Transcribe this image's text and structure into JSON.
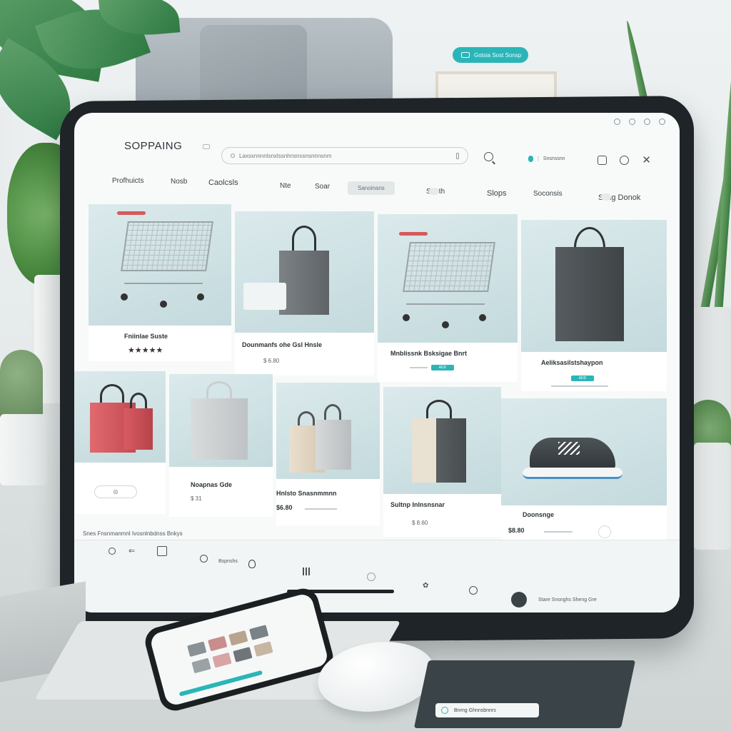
{
  "background_pill": {
    "text": "Gotsia Sost Sonsp"
  },
  "app": {
    "brand": "SOPPAING"
  },
  "search": {
    "placeholder": "Laxsxnnnnlsnxlssnhnsnxsnsnnnsnm",
    "value": ""
  },
  "account": {
    "label": "Snsnssnn"
  },
  "nav": {
    "items": [
      "Profhuicts",
      "Nosb",
      "Caolcsls",
      "Nte",
      "Soar",
      "Sanoinans",
      "Sonth",
      "Slops",
      "Soconsis",
      "Sling Donok"
    ]
  },
  "products_row1": [
    {
      "title": "Fniinlae Suste",
      "rating": "★★★★★",
      "price": ""
    },
    {
      "title": "Dounmanfs ohe Gsl Hnsle",
      "rating": "",
      "price": "$ 6.80"
    },
    {
      "title": "Mnblissnk Bsksigae Bnrt",
      "rating": "",
      "price": ""
    },
    {
      "title": "Aeliksasilstshaypon",
      "rating": "",
      "price": ""
    }
  ],
  "products_row2": [
    {
      "title": "",
      "price": ""
    },
    {
      "title": "Noapnas Gde",
      "price": "$ 31"
    },
    {
      "title": "Hnlsto Snasnmmnn",
      "price": "$6.80"
    },
    {
      "title": "Sultnp Inlnsnsnar",
      "price": "$ 8.60"
    },
    {
      "title": "Doonsnge",
      "price": "$8.80"
    }
  ],
  "footer": {
    "note": "Snes Fnsnmanmnl Ivosnlnbdnss Bnkys",
    "help_label": "Bspnshs",
    "right_text": "Stare Snsnghs Sheng Gre"
  },
  "notebook": {
    "label": "Bnrng Ghnnsbnnrs"
  },
  "colors": {
    "accent": "#2bb5b8",
    "tablet_bezel": "#1e2428",
    "card_bg": "#c4dadd"
  }
}
